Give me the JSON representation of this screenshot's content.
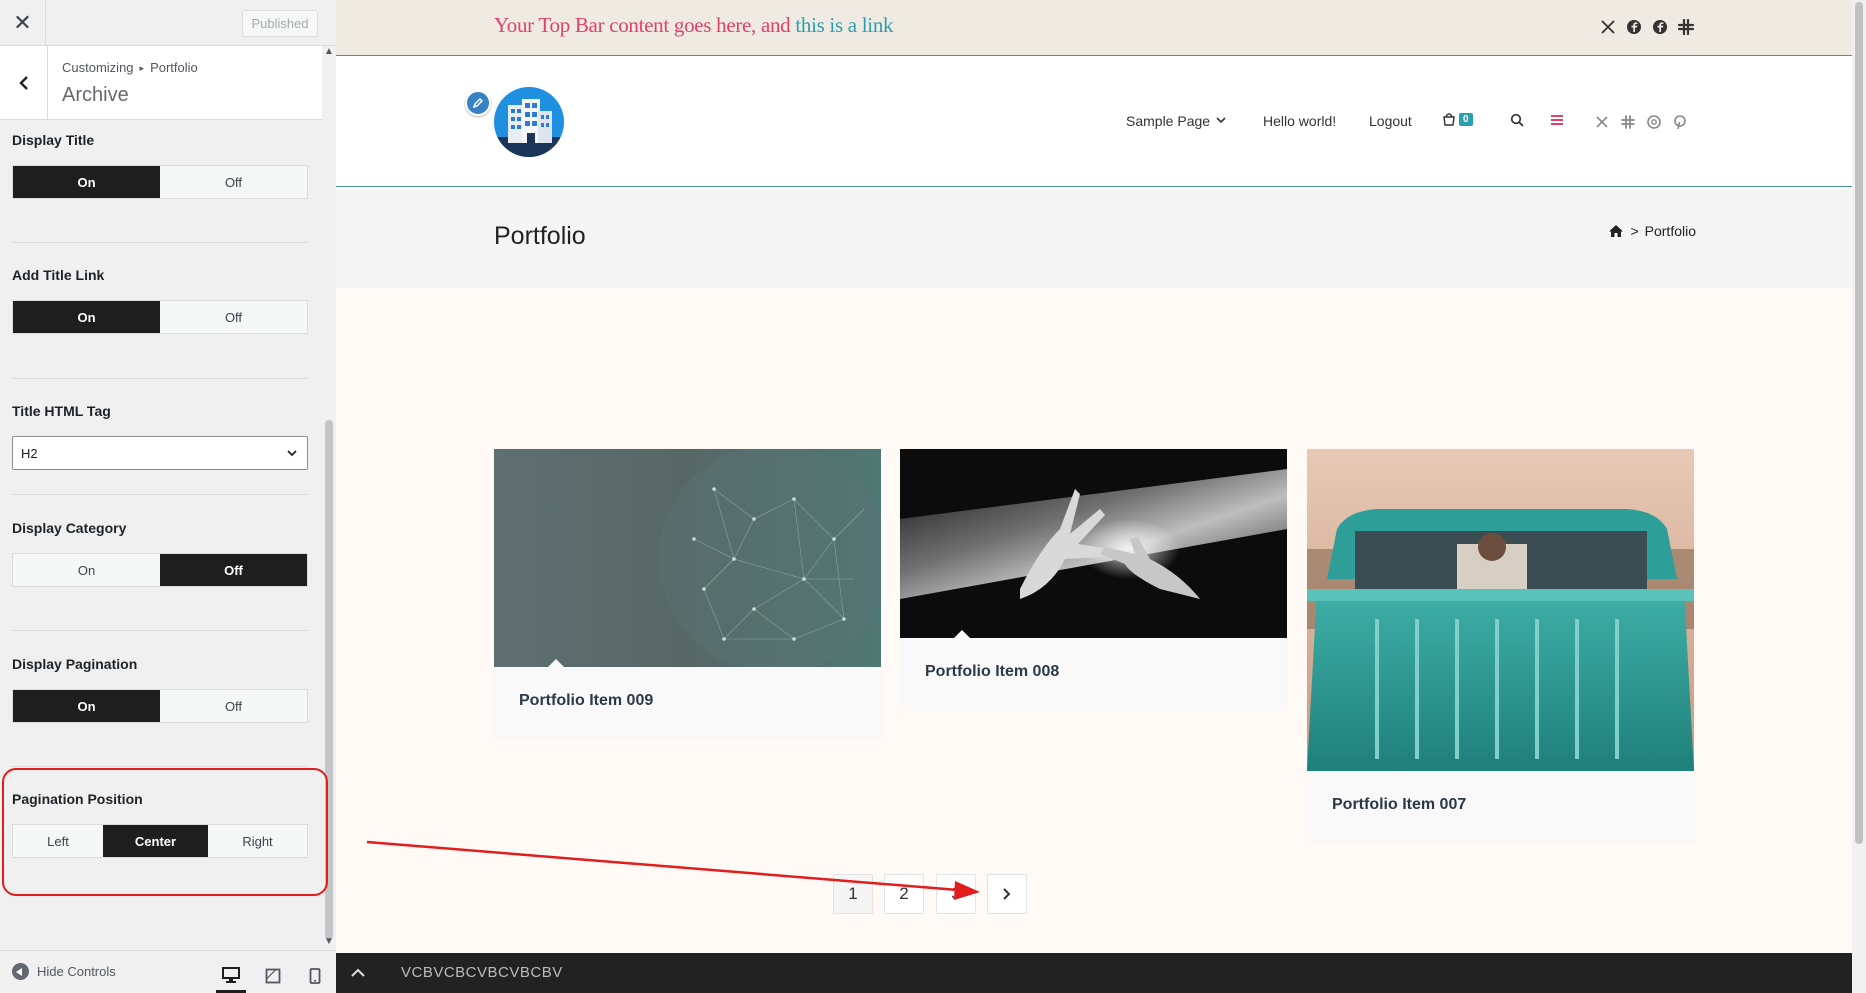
{
  "sidebar": {
    "close_label": "✕",
    "published_label": "Published",
    "breadcrumb": {
      "root": "Customizing",
      "separator": "▸",
      "parent": "Portfolio"
    },
    "section_title": "Archive",
    "controls": {
      "display_title": {
        "label": "Display Title",
        "options": [
          "On",
          "Off"
        ],
        "selected": "On"
      },
      "add_title_link": {
        "label": "Add Title Link",
        "options": [
          "On",
          "Off"
        ],
        "selected": "On"
      },
      "title_html_tag": {
        "label": "Title HTML Tag",
        "value": "H2"
      },
      "display_category": {
        "label": "Display Category",
        "options": [
          "On",
          "Off"
        ],
        "selected": "Off"
      },
      "display_pagination": {
        "label": "Display Pagination",
        "options": [
          "On",
          "Off"
        ],
        "selected": "On"
      },
      "pagination_position": {
        "label": "Pagination Position",
        "options": [
          "Left",
          "Center",
          "Right"
        ],
        "selected": "Center"
      }
    },
    "footer": {
      "hide_controls": "Hide Controls",
      "devices": [
        "desktop-icon",
        "tablet-icon",
        "mobile-icon"
      ],
      "active_device": "desktop"
    }
  },
  "preview": {
    "topbar": {
      "text": "Your Top Bar content goes here, and ",
      "link": "this is a link",
      "text_color": "#e0426c",
      "link_color": "#2a9fb0",
      "social_icons": [
        "x-icon",
        "facebook-icon",
        "facebook-icon",
        "slack-icon"
      ]
    },
    "nav": {
      "items": [
        "Sample Page",
        "Hello world!",
        "Logout"
      ],
      "cart_count": "0",
      "icons": [
        "cart-icon",
        "search-icon",
        "menu-icon"
      ],
      "social_icons": [
        "x-icon",
        "slack-icon",
        "threads-icon",
        "pinterest-icon"
      ]
    },
    "page_title": "Portfolio",
    "breadcrumb": {
      "separator": ">",
      "current": "Portfolio"
    },
    "portfolio_items": [
      {
        "title": "Portfolio Item 009"
      },
      {
        "title": "Portfolio Item 008"
      },
      {
        "title": "Portfolio Item 007"
      }
    ],
    "pagination": {
      "pages": [
        "1",
        "2",
        "3"
      ],
      "current": "1",
      "next_icon": "chevron-right-icon"
    },
    "bottom_bar": {
      "text": "VCBVCBCVBCVBCBV"
    }
  },
  "colors": {
    "accent": "#2a9fb0",
    "highlight": "#e11d1d",
    "active_button": "#1e1e1e"
  }
}
